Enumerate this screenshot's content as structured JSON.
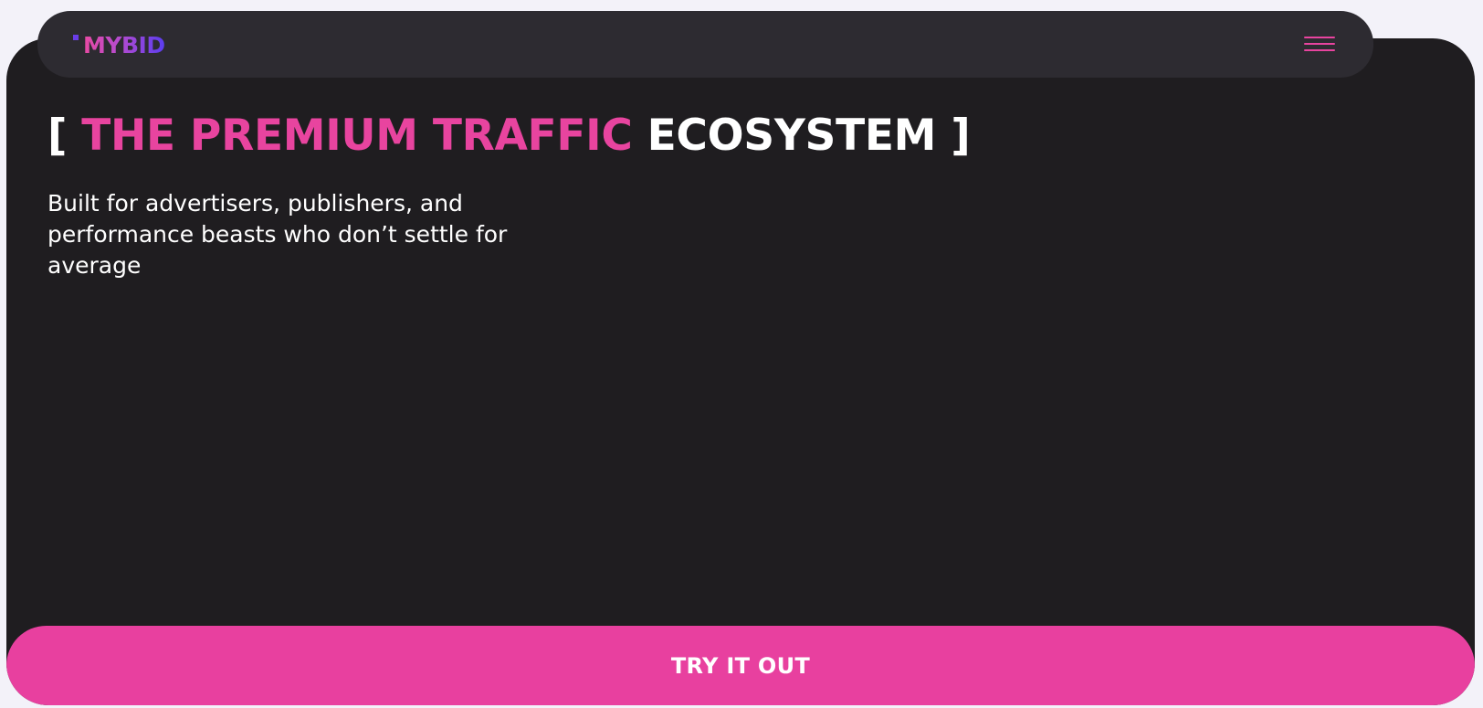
{
  "header": {
    "logo_text": "MYBID",
    "menu_icon": "hamburger-menu-icon"
  },
  "hero": {
    "bracket_open": "[",
    "headline_accent": "THE PREMIUM TRAFFIC",
    "headline_plain": "ECOSYSTEM",
    "bracket_close": "]",
    "subtitle": "Built for advertisers, publishers, and performance beasts who don’t settle for average"
  },
  "cta": {
    "label": "TRY IT OUT"
  },
  "colors": {
    "page_background": "#f3f2f9",
    "card_background": "#1f1d20",
    "navbar_background": "#2d2b31",
    "accent_pink": "#e8449f",
    "logo_purple": "#5a3df0",
    "text_white": "#ffffff"
  }
}
